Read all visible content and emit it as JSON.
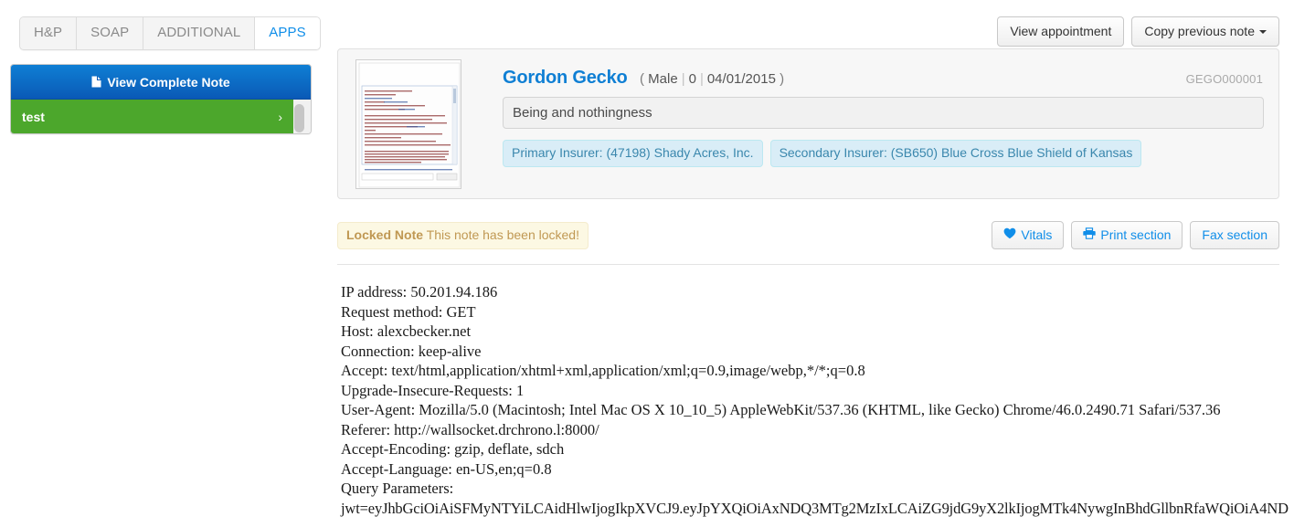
{
  "tabs": [
    {
      "label": "H&P",
      "active": false
    },
    {
      "label": "SOAP",
      "active": false
    },
    {
      "label": "ADDITIONAL",
      "active": false
    },
    {
      "label": "APPS",
      "active": true
    }
  ],
  "apps_panel": {
    "view_complete_note_label": "View Complete Note",
    "items": [
      {
        "label": "test"
      }
    ]
  },
  "topbar": {
    "view_appointment_label": "View appointment",
    "copy_previous_note_label": "Copy previous note"
  },
  "patient": {
    "name": "Gordon Gecko",
    "paren_open": "(",
    "gender": "Male",
    "age": "0",
    "dob": "04/01/2015",
    "paren_close": ")",
    "chart_id": "GEGO000001",
    "note_title": "Being and nothingness",
    "note_title_placeholder": "Note title",
    "insurers": [
      {
        "label": "Primary Insurer: (47198) Shady Acres, Inc."
      },
      {
        "label": "Secondary Insurer: (SB650) Blue Cross Blue Shield of Kansas"
      }
    ]
  },
  "locked_note": {
    "label": "Locked Note",
    "message": "This note has been locked!"
  },
  "section_actions": {
    "vitals_label": "Vitals",
    "print_section_label": "Print section",
    "fax_section_label": "Fax section"
  },
  "note_body": {
    "lines": [
      "IP address: 50.201.94.186",
      "Request method: GET",
      "Host: alexcbecker.net",
      "Connection: keep-alive",
      "Accept: text/html,application/xhtml+xml,application/xml;q=0.9,image/webp,*/*;q=0.8",
      "Upgrade-Insecure-Requests: 1",
      "User-Agent: Mozilla/5.0 (Macintosh; Intel Mac OS X 10_10_5) AppleWebKit/537.36 (KHTML, like Gecko) Chrome/46.0.2490.71 Safari/537.36",
      "Referer: http://wallsocket.drchrono.l:8000/",
      "Accept-Encoding: gzip, deflate, sdch",
      "Accept-Language: en-US,en;q=0.8",
      "Query Parameters:",
      "jwt=eyJhbGciOiAiSFMyNTYiLCAidHlwIjogIkpXVCJ9.eyJpYXQiOiAxNDQ3MTg2MzIxLCAiZG9jdG9yX2lkIjogMTk4NywgInBhdGllbnRfaWQiOiA4ND"
    ]
  },
  "colors": {
    "accent_blue": "#108ee9",
    "button_blue_top": "#0f7fd4",
    "button_blue_bottom": "#0a59b6",
    "app_green": "#4ca72c",
    "badge_bg": "#d9edf7",
    "badge_text": "#3a87ad",
    "locked_bg": "#fcf8e3",
    "locked_text": "#c09853",
    "card_bg": "#f7f7f7"
  }
}
